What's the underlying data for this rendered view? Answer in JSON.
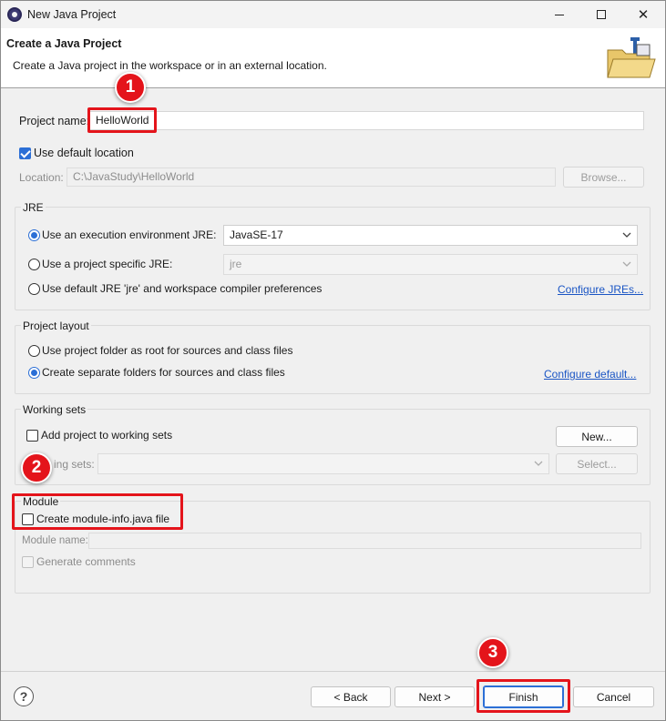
{
  "window": {
    "title": "New Java Project",
    "controls": {
      "minimize": "minimize-icon",
      "maximize": "maximize-icon",
      "close": "✕"
    }
  },
  "header": {
    "title": "Create a Java Project",
    "description": "Create a Java project in the workspace or in an external location."
  },
  "project": {
    "name_label": "Project name:",
    "name_value": "HelloWorld",
    "use_default_location_label": "Use default location",
    "use_default_location_checked": true,
    "location_label": "Location:",
    "location_value": "C:\\JavaStudy\\HelloWorld",
    "browse_label": "Browse..."
  },
  "jre": {
    "title": "JRE",
    "option_env_label": "Use an execution environment JRE:",
    "option_env_value": "JavaSE-17",
    "option_specific_label": "Use a project specific JRE:",
    "option_specific_value": "jre",
    "option_default_label": "Use default JRE 'jre' and workspace compiler preferences",
    "configure_link": "Configure JREs...",
    "selected": "env"
  },
  "project_layout": {
    "title": "Project layout",
    "option_root_label": "Use project folder as root for sources and class files",
    "option_separate_label": "Create separate folders for sources and class files",
    "configure_link": "Configure default...",
    "selected": "separate"
  },
  "working_sets": {
    "title": "Working sets",
    "add_label": "Add project to working sets",
    "new_button": "New...",
    "sets_label": "Working sets:",
    "sets_label_visible": "ing sets:",
    "select_button": "Select..."
  },
  "module": {
    "title": "Module",
    "create_label": "Create module-info.java file",
    "name_label": "Module name:",
    "generate_comments_label": "Generate comments"
  },
  "footer": {
    "help": "?",
    "back": "< Back",
    "next": "Next >",
    "finish": "Finish",
    "cancel": "Cancel"
  },
  "annotations": {
    "badge_1": "1",
    "badge_2": "2",
    "badge_3": "3",
    "highlight_color": "#e4141b"
  },
  "colors": {
    "accent": "#2b6fd6",
    "link": "#1a55c4"
  }
}
